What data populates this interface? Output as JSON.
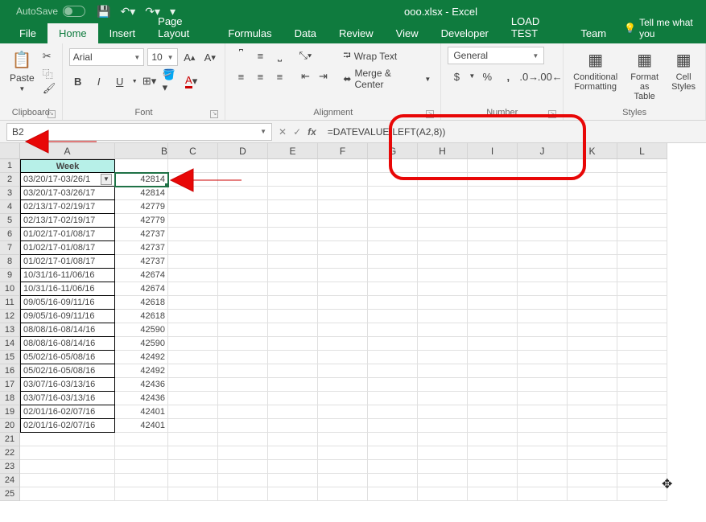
{
  "title": "ooo.xlsx  -  Excel",
  "autosave_label": "AutoSave",
  "tabs": {
    "file": "File",
    "home": "Home",
    "insert": "Insert",
    "page_layout": "Page Layout",
    "formulas": "Formulas",
    "data": "Data",
    "review": "Review",
    "view": "View",
    "developer": "Developer",
    "load_test": "LOAD TEST",
    "team": "Team"
  },
  "tellme": "Tell me what you",
  "ribbon": {
    "clipboard": {
      "label": "Clipboard",
      "paste": "Paste"
    },
    "font": {
      "label": "Font",
      "name": "Arial",
      "size": "10",
      "bold": "B",
      "italic": "I",
      "underline": "U"
    },
    "alignment": {
      "label": "Alignment",
      "wrap": "Wrap Text",
      "merge": "Merge & Center"
    },
    "number": {
      "label": "Number",
      "format": "General",
      "currency": "$",
      "percent": "%",
      "comma": ","
    },
    "styles": {
      "label": "Styles",
      "cond": "Conditional Formatting",
      "table": "Format as Table",
      "cell": "Cell Styles"
    }
  },
  "namebox": "B2",
  "formula": "=DATEVALUE(LEFT(A2,8))",
  "cols": [
    "A",
    "B",
    "C",
    "D",
    "E",
    "F",
    "G",
    "H",
    "I",
    "J",
    "K",
    "L"
  ],
  "header": "Week",
  "rows": [
    {
      "n": 1
    },
    {
      "n": 2,
      "a": "03/20/17-03/26/1",
      "b": "42814",
      "filter": true
    },
    {
      "n": 3,
      "a": "03/20/17-03/26/17",
      "b": "42814"
    },
    {
      "n": 4,
      "a": "02/13/17-02/19/17",
      "b": "42779"
    },
    {
      "n": 5,
      "a": "02/13/17-02/19/17",
      "b": "42779"
    },
    {
      "n": 6,
      "a": "01/02/17-01/08/17",
      "b": "42737"
    },
    {
      "n": 7,
      "a": "01/02/17-01/08/17",
      "b": "42737"
    },
    {
      "n": 8,
      "a": "01/02/17-01/08/17",
      "b": "42737"
    },
    {
      "n": 9,
      "a": "10/31/16-11/06/16",
      "b": "42674"
    },
    {
      "n": 10,
      "a": "10/31/16-11/06/16",
      "b": "42674"
    },
    {
      "n": 11,
      "a": "09/05/16-09/11/16",
      "b": "42618"
    },
    {
      "n": 12,
      "a": "09/05/16-09/11/16",
      "b": "42618"
    },
    {
      "n": 13,
      "a": "08/08/16-08/14/16",
      "b": "42590"
    },
    {
      "n": 14,
      "a": "08/08/16-08/14/16",
      "b": "42590"
    },
    {
      "n": 15,
      "a": "05/02/16-05/08/16",
      "b": "42492"
    },
    {
      "n": 16,
      "a": "05/02/16-05/08/16",
      "b": "42492"
    },
    {
      "n": 17,
      "a": "03/07/16-03/13/16",
      "b": "42436"
    },
    {
      "n": 18,
      "a": "03/07/16-03/13/16",
      "b": "42436"
    },
    {
      "n": 19,
      "a": "02/01/16-02/07/16",
      "b": "42401"
    },
    {
      "n": 20,
      "a": "02/01/16-02/07/16",
      "b": "42401"
    },
    {
      "n": 21
    },
    {
      "n": 22
    },
    {
      "n": 23
    },
    {
      "n": 24
    },
    {
      "n": 25
    }
  ]
}
